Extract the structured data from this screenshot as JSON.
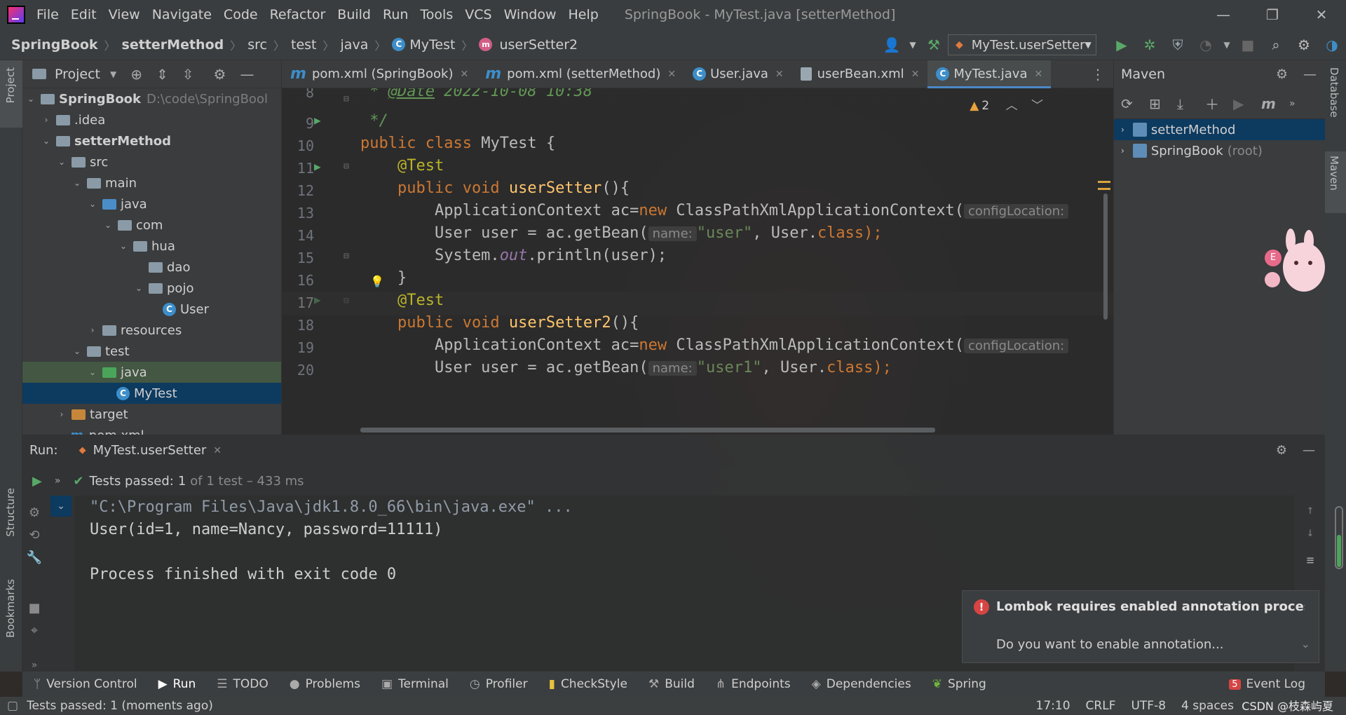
{
  "menubar": {
    "items": [
      "File",
      "Edit",
      "View",
      "Navigate",
      "Code",
      "Refactor",
      "Build",
      "Run",
      "Tools",
      "VCS",
      "Window",
      "Help"
    ],
    "title": "SpringBook - MyTest.java [setterMethod]",
    "minimize": "—",
    "restore": "❐",
    "close": "✕"
  },
  "breadcrumbs": {
    "items": [
      "SpringBook",
      "setterMethod",
      "src",
      "test",
      "java",
      "MyTest",
      "userSetter2"
    ]
  },
  "toolbar": {
    "run_config": "MyTest.userSetter"
  },
  "left_stripe": {
    "project": "Project",
    "structure": "Structure",
    "bookmarks": "Bookmarks"
  },
  "project_panel": {
    "title": "Project",
    "tree": [
      {
        "label": "SpringBook",
        "hint": "D:\\code\\SpringBool",
        "bold": true
      },
      {
        "label": ".idea"
      },
      {
        "label": "setterMethod",
        "bold": true
      },
      {
        "label": "src"
      },
      {
        "label": "main"
      },
      {
        "label": "java"
      },
      {
        "label": "com"
      },
      {
        "label": "hua"
      },
      {
        "label": "dao"
      },
      {
        "label": "pojo"
      },
      {
        "label": "User"
      },
      {
        "label": "resources"
      },
      {
        "label": "test"
      },
      {
        "label": "java"
      },
      {
        "label": "MyTest"
      },
      {
        "label": "target"
      },
      {
        "label": "pom.xml"
      }
    ]
  },
  "editor_tabs": [
    {
      "label": "pom.xml (SpringBook)"
    },
    {
      "label": "pom.xml (setterMethod)"
    },
    {
      "label": "User.java"
    },
    {
      "label": "userBean.xml"
    },
    {
      "label": "MyTest.java"
    }
  ],
  "editor": {
    "warnings": "2",
    "line_numbers": [
      "8",
      "9",
      "10",
      "11",
      "12",
      "13",
      "14",
      "15",
      "16",
      "17",
      "18",
      "19",
      "20"
    ],
    "code": {
      "l8_star": " * ",
      "l8_tag": "@Date",
      "l8_date": " 2022-10-08 10:38",
      "l9": " */",
      "l10_kw": "public class",
      "l10_rest": " MyTest {",
      "l11": "    @Test",
      "l12_kw": "    public void",
      "l12_fn": " userSetter",
      "l12_rest": "(){",
      "l13_a": "        ApplicationContext ac=",
      "l13_new": "new",
      "l13_b": " ClassPathXmlApplicationContext(",
      "l13_hint": "configLocation:",
      "l14_a": "        User user = ac.getBean(",
      "l14_hint": "name:",
      "l14_str": "\"user\"",
      "l14_b": ", User.",
      "l14_cls": "class",
      "l14_c": ");",
      "l15_a": "        System.",
      "l15_out": "out",
      "l15_b": ".println(user);",
      "l16": "    }",
      "l17": "    @Test",
      "l18_kw": "    public void",
      "l18_fn": " userSetter2",
      "l18_rest": "(){",
      "l19_a": "        ApplicationContext ac=",
      "l19_new": "new",
      "l19_b": " ClassPathXmlApplicationContext(",
      "l19_hint": "configLocation:",
      "l20_a": "        User user = ac.getBean(",
      "l20_hint": "name:",
      "l20_str": "\"user1\"",
      "l20_b": ", User.",
      "l20_cls": "class",
      "l20_c": ");"
    }
  },
  "maven_panel": {
    "title": "Maven",
    "items": [
      {
        "label": "setterMethod"
      },
      {
        "label": "SpringBook",
        "suffix": "(root)"
      }
    ]
  },
  "right_stripe": {
    "database": "Database",
    "maven": "Maven"
  },
  "run_panel": {
    "label": "Run:",
    "tab": "MyTest.userSetter",
    "tests_passed_prefix": "Tests passed:",
    "tests_passed_count": "1",
    "tests_passed_suffix": "of 1 test – 433 ms",
    "console": [
      "\"C:\\Program Files\\Java\\jdk1.8.0_66\\bin\\java.exe\" ...",
      "User(id=1, name=Nancy, password=11111)",
      "",
      "Process finished with exit code 0"
    ]
  },
  "notification": {
    "title": "Lombok requires enabled annotation processing",
    "body": "Do you want to enable annotation..."
  },
  "tool_windows": [
    {
      "label": "Version Control",
      "icon": "branch-icon"
    },
    {
      "label": "Run",
      "icon": "play-icon"
    },
    {
      "label": "TODO",
      "icon": "list-icon"
    },
    {
      "label": "Problems",
      "icon": "info-icon"
    },
    {
      "label": "Terminal",
      "icon": "terminal-icon"
    },
    {
      "label": "Profiler",
      "icon": "profiler-icon"
    },
    {
      "label": "CheckStyle",
      "icon": "checkstyle-icon"
    },
    {
      "label": "Build",
      "icon": "hammer-icon"
    },
    {
      "label": "Endpoints",
      "icon": "endpoints-icon"
    },
    {
      "label": "Dependencies",
      "icon": "layers-icon"
    },
    {
      "label": "Spring",
      "icon": "leaf-icon"
    }
  ],
  "event_log": {
    "count": "5",
    "label": "Event Log"
  },
  "status_bar": {
    "message": "Tests passed: 1 (moments ago)",
    "position": "17:10",
    "line_sep": "CRLF",
    "encoding": "UTF-8",
    "indent": "4 spaces"
  },
  "watermark": "CSDN @枝森屿夏"
}
